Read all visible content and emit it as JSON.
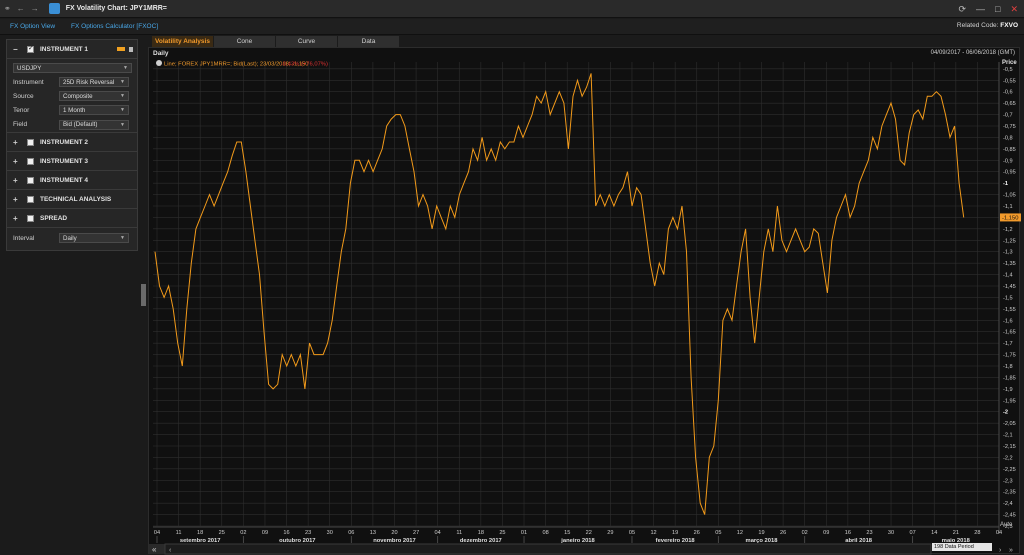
{
  "window": {
    "title": "FX Volatility Chart: JPY1MRR=",
    "close_glyph": "✕",
    "refresh_glyph": "⟳",
    "max_glyph": "□",
    "min_glyph": "—"
  },
  "linkbar": {
    "link1": "FX Option View",
    "link2": "FX Options Calculator [FXOC]",
    "related_label": "Related Code:",
    "related_code": "FXVO"
  },
  "sidebar": {
    "instrument1": {
      "title": "INSTRUMENT 1",
      "currency_pair": "USDJPY",
      "rows": [
        {
          "label": "Instrument",
          "value": "25D Risk Reversal"
        },
        {
          "label": "Source",
          "value": "Composite"
        },
        {
          "label": "Tenor",
          "value": "1 Month"
        },
        {
          "label": "Field",
          "value": "Bid (Default)"
        }
      ]
    },
    "sections": [
      "INSTRUMENT 2",
      "INSTRUMENT 3",
      "INSTRUMENT 4",
      "TECHNICAL ANALYSIS",
      "SPREAD"
    ],
    "interval_label": "Interval",
    "interval_value": "Daily"
  },
  "tabs": [
    "Volatility Analysis",
    "Cone",
    "Curve",
    "Data"
  ],
  "chart_header": {
    "frequency": "Daily",
    "date_range": "04/09/2017 - 06/06/2018 (GMT)",
    "legend": "Line; FOREX JPY1MRR=; Bid(Last); 23/03/2018; -1,150",
    "legend_change": "-0,43% (+76,07%)",
    "last_value_label": "-1,150",
    "period": "198 Data Period"
  },
  "colors": {
    "line": "#f29a1a",
    "accent": "#f29a2b",
    "grid": "#2e2e2e",
    "link": "#4aa8e8"
  },
  "chart_data": {
    "type": "line",
    "ylabel": "Price",
    "yticks": [
      "-0,5",
      "-0,55",
      "-0,6",
      "-0,65",
      "-0,7",
      "-0,75",
      "-0,8",
      "-0,85",
      "-0,9",
      "-0,95",
      "-1",
      "-1,05",
      "-1,1",
      "-1,15",
      "-1,2",
      "-1,25",
      "-1,3",
      "-1,35",
      "-1,4",
      "-1,45",
      "-1,5",
      "-1,55",
      "-1,6",
      "-1,65",
      "-1,7",
      "-1,75",
      "-1,8",
      "-1,85",
      "-1,9",
      "-1,95",
      "-2",
      "-2,05",
      "-2,1",
      "-2,15",
      "-2,2",
      "-2,25",
      "-2,3",
      "-2,35",
      "-2,4",
      "-2,45",
      "-2,5"
    ],
    "ylim": [
      -2.5,
      -0.47
    ],
    "day_ticks": [
      "04",
      "11",
      "18",
      "25",
      "02",
      "09",
      "16",
      "23",
      "30",
      "06",
      "13",
      "20",
      "27",
      "04",
      "11",
      "18",
      "25",
      "01",
      "08",
      "15",
      "22",
      "29",
      "05",
      "12",
      "19",
      "26",
      "05",
      "12",
      "19",
      "26",
      "02",
      "09",
      "16",
      "23",
      "30",
      "07",
      "14",
      "21",
      "28",
      "04"
    ],
    "months": [
      "setembro 2017",
      "outubro 2017",
      "novembro 2017",
      "dezembro 2017",
      "janeiro 2018",
      "fevereiro 2018",
      "março 2018",
      "abril 2018",
      "maio 2018"
    ],
    "series": [
      {
        "values": [
          -1.3,
          -1.45,
          -1.5,
          -1.45,
          -1.55,
          -1.7,
          -1.8,
          -1.55,
          -1.35,
          -1.2,
          -1.15,
          -1.1,
          -1.05,
          -1.1,
          -1.05,
          -1.0,
          -0.95,
          -0.88,
          -0.82,
          -0.82,
          -0.95,
          -1.1,
          -1.25,
          -1.4,
          -1.65,
          -1.88,
          -1.9,
          -1.88,
          -1.75,
          -1.8,
          -1.75,
          -1.8,
          -1.75,
          -1.9,
          -1.7,
          -1.75,
          -1.75,
          -1.75,
          -1.7,
          -1.6,
          -1.45,
          -1.3,
          -1.2,
          -1.0,
          -0.9,
          -0.9,
          -0.95,
          -0.9,
          -0.95,
          -0.9,
          -0.85,
          -0.75,
          -0.72,
          -0.7,
          -0.7,
          -0.75,
          -0.85,
          -0.95,
          -1.1,
          -1.05,
          -1.1,
          -1.2,
          -1.1,
          -1.15,
          -1.2,
          -1.1,
          -1.15,
          -1.05,
          -1.0,
          -0.95,
          -0.85,
          -0.9,
          -0.8,
          -0.9,
          -0.85,
          -0.9,
          -0.82,
          -0.85,
          -0.82,
          -0.82,
          -0.75,
          -0.8,
          -0.75,
          -0.7,
          -0.62,
          -0.65,
          -0.6,
          -0.7,
          -0.65,
          -0.6,
          -0.65,
          -0.85,
          -0.62,
          -0.55,
          -0.62,
          -0.58,
          -0.52,
          -1.1,
          -1.05,
          -1.1,
          -1.05,
          -1.1,
          -1.05,
          -1.02,
          -0.95,
          -1.1,
          -1.02,
          -1.05,
          -1.2,
          -1.35,
          -1.45,
          -1.35,
          -1.4,
          -1.2,
          -1.15,
          -1.2,
          -1.1,
          -1.3,
          -1.85,
          -2.2,
          -2.4,
          -2.45,
          -2.2,
          -2.15,
          -1.95,
          -1.6,
          -1.55,
          -1.6,
          -1.45,
          -1.3,
          -1.2,
          -1.5,
          -1.7,
          -1.5,
          -1.3,
          -1.2,
          -1.3,
          -1.1,
          -1.25,
          -1.3,
          -1.25,
          -1.2,
          -1.25,
          -1.3,
          -1.28,
          -1.2,
          -1.22,
          -1.35,
          -1.48,
          -1.25,
          -1.15,
          -1.1,
          -1.05,
          -1.15,
          -1.1,
          -1.0,
          -0.95,
          -0.9,
          -0.8,
          -0.85,
          -0.75,
          -0.7,
          -0.65,
          -0.72,
          -0.9,
          -0.92,
          -0.78,
          -0.7,
          -0.68,
          -0.72,
          -0.62,
          -0.62,
          -0.6,
          -0.62,
          -0.7,
          -0.8,
          -0.75,
          -1.0,
          -1.15
        ]
      }
    ]
  }
}
